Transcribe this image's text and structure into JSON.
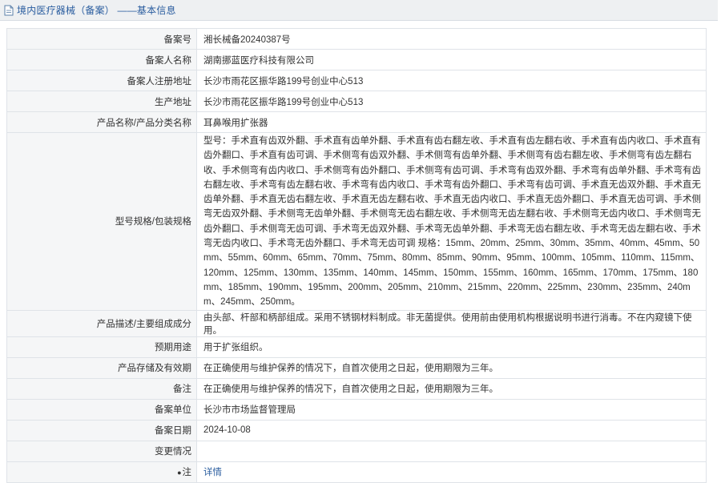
{
  "header": {
    "title": "境内医疗器械（备案） ——基本信息"
  },
  "rows": [
    {
      "label": "备案号",
      "value": "湘长械备20240387号"
    },
    {
      "label": "备案人名称",
      "value": "湖南挪蓝医疗科技有限公司"
    },
    {
      "label": "备案人注册地址",
      "value": "长沙市雨花区振华路199号创业中心513"
    },
    {
      "label": "生产地址",
      "value": "长沙市雨花区振华路199号创业中心513"
    },
    {
      "label": "产品名称/产品分类名称",
      "value": "耳鼻喉用扩张器"
    },
    {
      "label": "型号规格/包装规格",
      "value": "型号：手术直有齿双外翻、手术直有齿单外翻、手术直有齿右翻左收、手术直有齿左翻右收、手术直有齿内收口、手术直有齿外翻口、手术直有齿可调、手术侧弯有齿双外翻、手术侧弯有齿单外翻、手术侧弯有齿右翻左收、手术侧弯有齿左翻右收、手术侧弯有齿内收口、手术侧弯有齿外翻口、手术侧弯有齿可调、手术弯有齿双外翻、手术弯有齿单外翻、手术弯有齿右翻左收、手术弯有齿左翻右收、手术弯有齿内收口、手术弯有齿外翻口、手术弯有齿可调、手术直无齿双外翻、手术直无齿单外翻、手术直无齿右翻左收、手术直无齿左翻右收、手术直无齿内收口、手术直无齿外翻口、手术直无齿可调、手术侧弯无齿双外翻、手术侧弯无齿单外翻、手术侧弯无齿右翻左收、手术侧弯无齿左翻右收、手术侧弯无齿内收口、手术侧弯无齿外翻口、手术侧弯无齿可调、手术弯无齿双外翻、手术弯无齿单外翻、手术弯无齿右翻左收、手术弯无齿左翻右收、手术弯无齿内收口、手术弯无齿外翻口、手术弯无齿可调 规格：15mm、20mm、25mm、30mm、35mm、40mm、45mm、50mm、55mm、60mm、65mm、70mm、75mm、80mm、85mm、90mm、95mm、100mm、105mm、110mm、115mm、120mm、125mm、130mm、135mm、140mm、145mm、150mm、155mm、160mm、165mm、170mm、175mm、180mm、185mm、190mm、195mm、200mm、205mm、210mm、215mm、220mm、225mm、230mm、235mm、240mm、245mm、250mm。"
    },
    {
      "label": "产品描述/主要组成成分",
      "value": "由头部、杆部和柄部组成。采用不锈钢材料制成。非无菌提供。使用前由使用机构根据说明书进行消毒。不在内窥镜下使用。"
    },
    {
      "label": "预期用途",
      "value": "用于扩张组织。"
    },
    {
      "label": "产品存储及有效期",
      "value": "在正确使用与维护保养的情况下，自首次使用之日起，使用期限为三年。"
    },
    {
      "label": "备注",
      "value": "在正确使用与维护保养的情况下，自首次使用之日起，使用期限为三年。"
    },
    {
      "label": "备案单位",
      "value": "长沙市市场监督管理局"
    },
    {
      "label": "备案日期",
      "value": "2024-10-08"
    },
    {
      "label": "变更情况",
      "value": ""
    },
    {
      "label": "注",
      "value": "详情"
    }
  ],
  "colors": {
    "title_link": "#2a5d9f",
    "label_bg": "#f5f6f7",
    "border": "#dfe3e8",
    "header_bg": "#eef0f2"
  },
  "icons": [
    "document-icon",
    "pin-icon"
  ]
}
